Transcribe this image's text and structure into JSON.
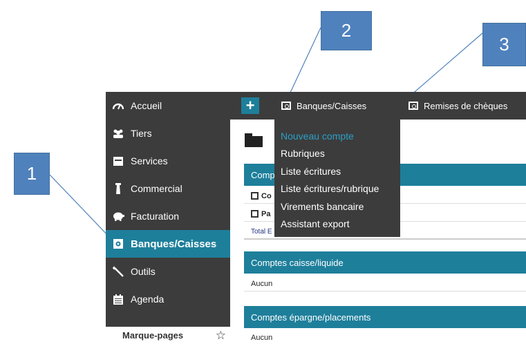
{
  "callouts": [
    "1",
    "2",
    "3"
  ],
  "sidebar": {
    "items": [
      {
        "label": "Accueil",
        "icon": "dashboard-icon"
      },
      {
        "label": "Tiers",
        "icon": "users-icon"
      },
      {
        "label": "Services",
        "icon": "services-icon"
      },
      {
        "label": "Commercial",
        "icon": "commercial-icon"
      },
      {
        "label": "Facturation",
        "icon": "piggy-bank-icon"
      },
      {
        "label": "Banques/Caisses",
        "icon": "bank-icon",
        "active": true
      },
      {
        "label": "Outils",
        "icon": "wand-icon"
      },
      {
        "label": "Agenda",
        "icon": "calendar-icon"
      }
    ],
    "bookmarks_label": "Marque-pages",
    "bookmarks_icon": "☆"
  },
  "topbar": {
    "plus_label": "+",
    "tabs": [
      {
        "label": "Banques/Caisses"
      },
      {
        "label": "Remises de chèques"
      }
    ]
  },
  "dropdown": {
    "items": [
      {
        "label": "Nouveau compte",
        "highlighted": true
      },
      {
        "label": "Rubriques"
      },
      {
        "label": "Liste écritures"
      },
      {
        "label": "Liste écritures/rubrique"
      },
      {
        "label": "Virements bancaire"
      },
      {
        "label": "Assistant export"
      }
    ]
  },
  "main": {
    "sections": [
      {
        "header": "Comptes",
        "rows": [
          "Co",
          "Pa"
        ],
        "total": "Total E"
      },
      {
        "header": "Comptes caisse/liquide",
        "rows": [
          "Aucun"
        ]
      },
      {
        "header": "Comptes épargne/placements",
        "rows": [
          "Aucun"
        ]
      }
    ]
  },
  "colors": {
    "dark_bg": "#3c3c3c",
    "accent": "#1e7f9b",
    "highlight_text": "#2aa0c8",
    "callout_blue": "#4f81bd"
  }
}
